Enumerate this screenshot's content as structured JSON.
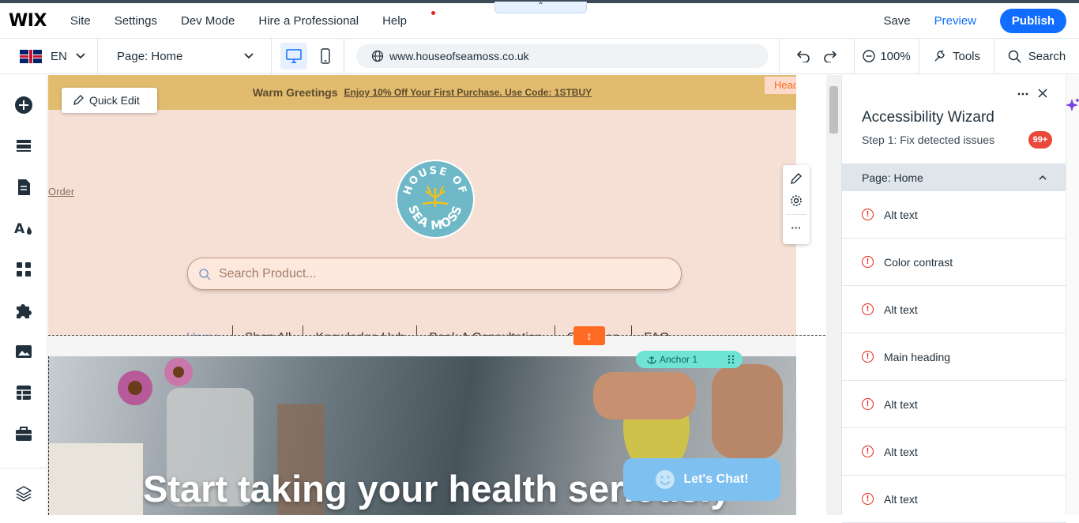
{
  "topbar": {
    "logo": "WIX",
    "menu": [
      "Site",
      "Settings",
      "Dev Mode",
      "Hire a Professional",
      "Help"
    ],
    "collapse_glyph": "⌃",
    "save_label": "Save",
    "preview_label": "Preview",
    "publish_label": "Publish"
  },
  "toolbar2": {
    "language": "EN",
    "page_selector": "Page: Home",
    "url": "www.houseofseamoss.co.uk",
    "zoom": "100%",
    "tools_label": "Tools",
    "search_label": "Search"
  },
  "site": {
    "banner_bold": "Warm Greetings",
    "banner_link": "Enjoy 10% Off Your First Purchase. Use Code: 1STBUY",
    "header_tag": "Head",
    "order_link": "Order",
    "logo_text_top": "HOUSE OF",
    "logo_text_bottom": "SEA MOSS",
    "search_placeholder": "Search Product...",
    "nav": [
      "Home",
      "Shop All",
      "Knowledge Hub",
      "Book A Consultation",
      "Gift Shop",
      "FAQ"
    ],
    "anchor_label": "Anchor 1",
    "hero_title": "Start taking your health seriously",
    "chat_label": "Let's Chat!"
  },
  "editor": {
    "quick_edit_label": "Quick Edit",
    "resize_glyph": "↕",
    "more_glyph": "···"
  },
  "panel": {
    "title": "Accessibility Wizard",
    "subtitle": "Step 1: Fix detected issues",
    "badge": "99+",
    "section": "Page: Home",
    "issues": [
      "Alt text",
      "Color contrast",
      "Alt text",
      "Main heading",
      "Alt text",
      "Alt text",
      "Alt text"
    ]
  },
  "colors": {
    "accent": "#116dff",
    "banner": "#e2bc6e",
    "header_bg": "#f6e0d6",
    "warning": "#e62214",
    "handle": "#ff6a22"
  }
}
